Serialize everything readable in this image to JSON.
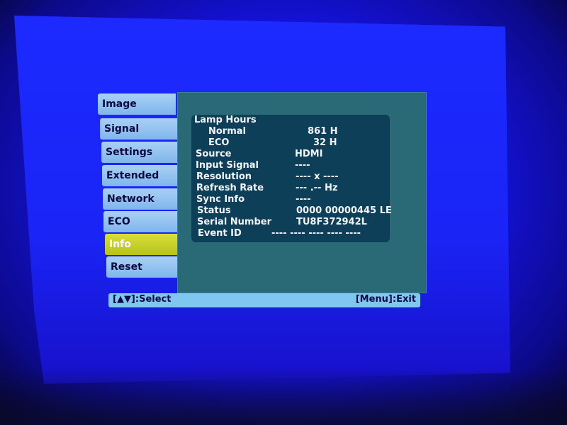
{
  "sidebar": {
    "items": [
      {
        "label": "Image"
      },
      {
        "label": "Signal"
      },
      {
        "label": "Settings"
      },
      {
        "label": "Extended"
      },
      {
        "label": "Network"
      },
      {
        "label": "ECO"
      },
      {
        "label": "Info",
        "active": true
      },
      {
        "label": "Reset"
      }
    ]
  },
  "info": {
    "rows": [
      {
        "label": "Lamp Hours",
        "value": ""
      },
      {
        "label": "Normal",
        "value": "861 H"
      },
      {
        "label": "ECO",
        "value": "32 H"
      },
      {
        "label": "Source",
        "value": "HDMI"
      },
      {
        "label": "Input Signal",
        "value": "----"
      },
      {
        "label": "Resolution",
        "value": "---- x ----"
      },
      {
        "label": "Refresh Rate",
        "value": "--- .-- Hz"
      },
      {
        "label": "Sync Info",
        "value": "----"
      },
      {
        "label": "Status",
        "value": "0000 00000445 LE"
      },
      {
        "label": "Serial Number",
        "value": "TU8F372942L"
      },
      {
        "label": "Event ID",
        "value": "---- ---- ---- ---- ----"
      }
    ]
  },
  "footer": {
    "left": "[▲▼]:Select",
    "right": "[Menu]:Exit"
  },
  "colors": {
    "screen_blue": "#1a24f5",
    "panel": "#2a6a76",
    "info_box": "#0d3f58",
    "tab": "#7fb6ec",
    "active_tab": "#c9cf2a",
    "footer": "#7fc7f0"
  }
}
